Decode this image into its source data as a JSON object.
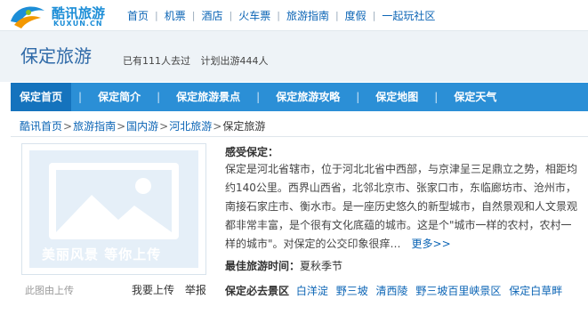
{
  "logo": {
    "text": "酷讯旅游",
    "sub": "KUXUN.CN"
  },
  "topnav": [
    "首页",
    "机票",
    "酒店",
    "火车票",
    "旅游指南",
    "度假",
    "一起玩社区"
  ],
  "title": "保定旅游",
  "stats": {
    "been": "已有111人去过",
    "plan": "计划出游444人"
  },
  "tabs": [
    "保定首页",
    "保定简介",
    "保定旅游景点",
    "保定旅游攻略",
    "保定地图",
    "保定天气"
  ],
  "breadcrumb": [
    "酷讯首页",
    "旅游指南",
    "国内游",
    "河北旅游",
    "保定旅游"
  ],
  "image": {
    "placeholder": "美丽风景 等你上传",
    "caption": "此图由上传",
    "upload": "我要上传",
    "report": "举报"
  },
  "intro": {
    "heading": "感受保定：",
    "text": "保定是河北省辖市，位于河北北省中西部，与京津呈三足鼎立之势，相距均约140公里。西界山西省，北邻北京市、张家口市，东临廊坊市、沧州市，南接石家庄市、衡水市。是一座历史悠久的新型城市，自然景观和人文景观都非常丰富，是个很有文化底蕴的城市。这是个\"城市一样的农村，农村一样的城市\"。对保定的公交印象很痒…",
    "more": "更多>>"
  },
  "season": {
    "label": "最佳旅游时间：",
    "value": "夏秋季节"
  },
  "spots": {
    "label": "保定必去景区",
    "items": [
      "白洋淀",
      "野三坡",
      "清西陵",
      "野三坡百里峡景区",
      "保定白草畔"
    ]
  },
  "colors": {
    "brand": "#1d8ed7",
    "tabbar": "#2b8fd6",
    "tab_active": "#1573bd",
    "link": "#0b64b5"
  }
}
